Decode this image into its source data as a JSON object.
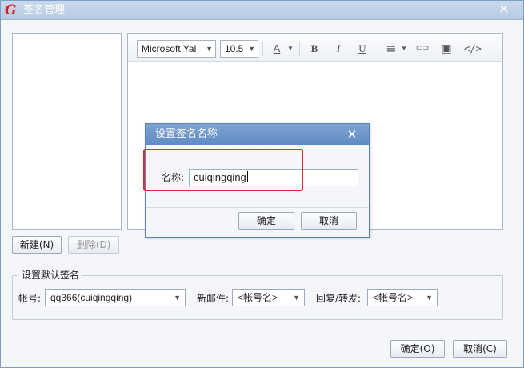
{
  "window": {
    "title": "签名管理",
    "close": "✕"
  },
  "toolbar": {
    "font_family": "Microsoft Yal",
    "font_size": "10.5",
    "font_color_glyph": "A",
    "bold": "B",
    "italic": "I",
    "underline": "U",
    "align_glyph": "≡",
    "link_glyph": "⊂⊃",
    "image_glyph": "▣",
    "source_glyph": "</>"
  },
  "buttons": {
    "new": "新建(N)",
    "delete": "删除(D)",
    "ok": "确定(O)",
    "cancel": "取消(C)"
  },
  "default_group": {
    "legend": "设置默认签名",
    "account_label": "帐号:",
    "account_value": "qq366(cuiqingqing)",
    "new_mail_label": "新邮件:",
    "new_mail_value": "<帐号名>",
    "reply_label": "回复/转发:",
    "reply_value": "<帐号名>"
  },
  "dialog": {
    "title": "设置签名名称",
    "close": "✕",
    "name_label": "名称:",
    "name_value": "cuiqingqing",
    "ok": "确定",
    "cancel": "取消"
  },
  "colors": {
    "highlight": "#e52a2a",
    "title_bar": "#6f97c9"
  }
}
